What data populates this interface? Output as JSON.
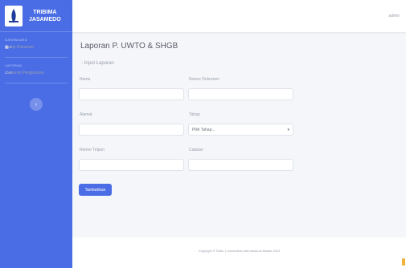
{
  "sidebar": {
    "brand_line1": "TRIBIMA",
    "brand_line2": "JASAMEDO",
    "section1_heading": "Dashboard",
    "item1_label": "Arsip Dokumen",
    "section2_heading": "Laporan",
    "item2_label": "Laporan Pengukuran",
    "toggle_icon": "chevron-left-icon"
  },
  "topbar": {
    "user_name": "admin"
  },
  "page": {
    "title": "Laporan P. UWTO & SHGB",
    "card_subtitle": "Input Laporan"
  },
  "form": {
    "nama_label": "Nama",
    "nama_value": "",
    "nomor_dokumen_label": "Nomor Dokumen",
    "nomor_dokumen_value": "",
    "alamat_label": "Alamat",
    "alamat_value": "",
    "tahap_label": "Tahap",
    "tahap_selected": "Pilih Tahap...",
    "nomor_telepon_label": "Nomor Telpon",
    "nomor_telepon_value": "",
    "catatan_label": "Catatan",
    "catatan_value": "",
    "submit_label": "Tambahkan"
  },
  "footer": {
    "text": "Copyright © Radu | Universitas Internasional Batam 2023"
  },
  "colors": {
    "primary": "#4a6de5",
    "background": "#f4f6f9",
    "accent_marker": "#f0b43c"
  }
}
